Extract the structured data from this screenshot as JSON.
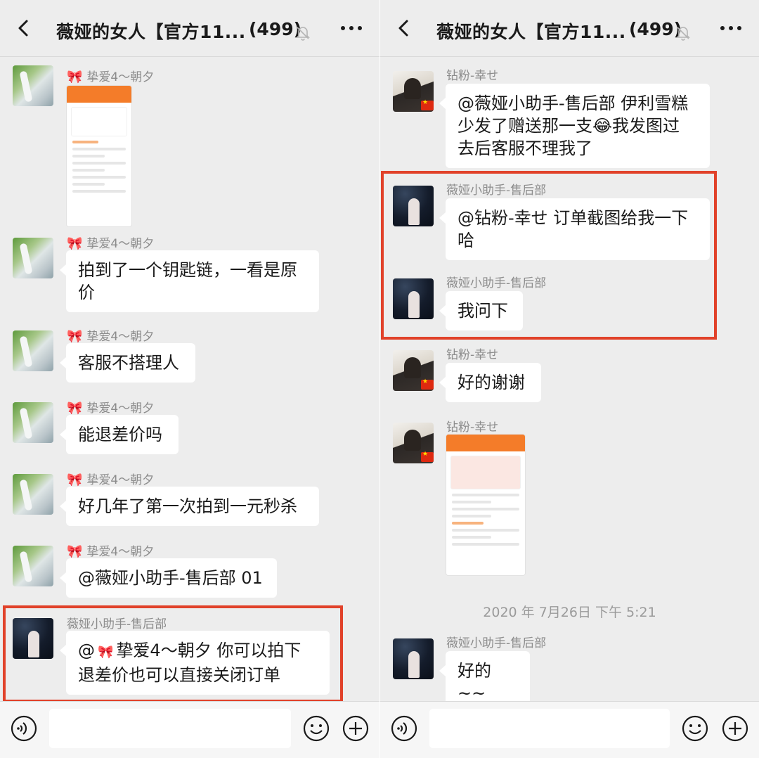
{
  "left": {
    "header": {
      "title": "薇娅的女人【官方11...",
      "count": "(499)"
    },
    "messages": [
      {
        "sender": "挚爱4～朝夕",
        "type": "image"
      },
      {
        "sender": "挚爱4～朝夕",
        "text_line1": "拍到了一个钥匙链，一看是原",
        "text_line2": "价"
      },
      {
        "sender": "挚爱4～朝夕",
        "text": "客服不搭理人"
      },
      {
        "sender": "挚爱4～朝夕",
        "text": "能退差价吗"
      },
      {
        "sender": "挚爱4～朝夕",
        "text": "好几年了第一次拍到一元秒杀"
      },
      {
        "sender": "挚爱4～朝夕",
        "text": "@薇娅小助手-售后部 01"
      },
      {
        "sender": "薇娅小助手-售后部",
        "text_prefix": "@",
        "text_mention": "挚爱4～朝夕 你可以拍下",
        "text_line2": "退差价也可以直接关闭订单"
      }
    ]
  },
  "right": {
    "header": {
      "title": "薇娅的女人【官方11...",
      "count": "(499)"
    },
    "messages": [
      {
        "sender": "钻粉-幸せ",
        "text_line1": "@薇娅小助手-售后部 伊利雪糕",
        "text_line2a": "少发了赠送那一支",
        "text_line2b": "我发图过",
        "text_line3": "去后客服不理我了"
      },
      {
        "sender": "薇娅小助手-售后部",
        "text_line1": "@钻粉-幸せ 订单截图给我一下",
        "text_line2": "哈"
      },
      {
        "sender": "薇娅小助手-售后部",
        "text": "我问下"
      },
      {
        "sender": "钻粉-幸せ",
        "text": "好的谢谢"
      },
      {
        "sender": "钻粉-幸せ",
        "type": "image"
      },
      {
        "sender": "薇娅小助手-售后部",
        "text": "好的 ~~"
      }
    ],
    "timestamp": "2020 年 7月26日 下午 5:21"
  },
  "icons": {
    "back": "chevron-left-icon",
    "mute": "bell-off-icon",
    "more": "more-icon",
    "voice": "voice-icon",
    "emoji": "emoji-icon",
    "add": "plus-icon",
    "bow": "bow-emoji",
    "cry": "crying-laughing-emoji"
  },
  "colors": {
    "highlight": "#e1422a",
    "background": "#ededed",
    "bubble": "#ffffff",
    "accent_orange": "#f47c29"
  }
}
